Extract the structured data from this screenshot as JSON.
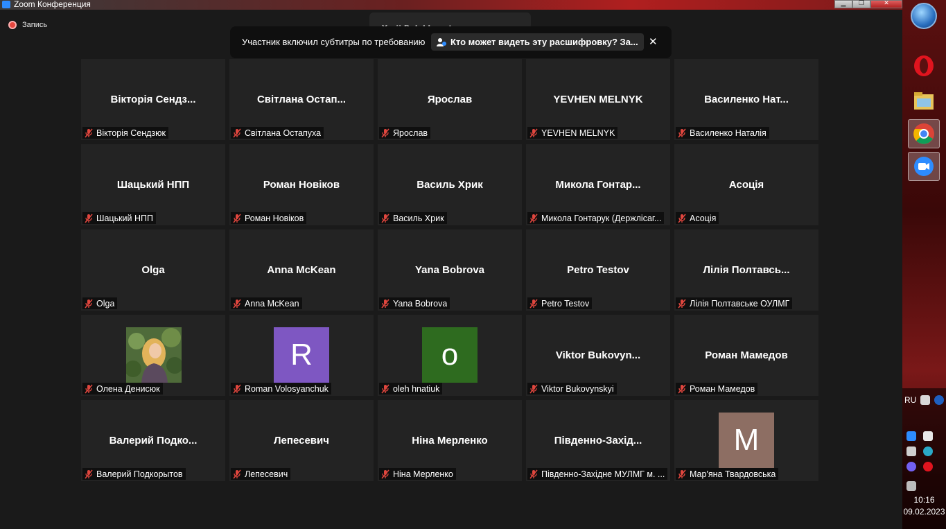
{
  "window": {
    "title": "Zoom Конференция",
    "minimize": "▁",
    "maximize": "❐",
    "close": "✕"
  },
  "recording": {
    "label": "Запись"
  },
  "speaker": {
    "text": "Yurii Bolokhovets разговаривает..."
  },
  "banner": {
    "message": "Участник включил субтитры по требованию",
    "who_can_see": "Кто может видеть эту расшифровку? За...",
    "close": "✕"
  },
  "tiles": [
    {
      "big": "Вікторія  Сендз...",
      "label": "Вікторія Сендзюк",
      "muted": true
    },
    {
      "big": "Світлана  Остап...",
      "label": "Світлана Остапуха",
      "muted": true
    },
    {
      "big": "Ярослав",
      "label": "Ярослав",
      "muted": true
    },
    {
      "big": "YEVHEN MELNYK",
      "label": "YEVHEN MELNYK",
      "muted": true
    },
    {
      "big": "Василенко  Нат...",
      "label": "Василенко Наталія",
      "muted": true
    },
    {
      "big": "Шацький НПП",
      "label": "Шацький НПП",
      "muted": true
    },
    {
      "big": "Роман Новіков",
      "label": "Роман Новіков",
      "muted": true
    },
    {
      "big": "Василь Хрик",
      "label": "Василь Хрик",
      "muted": true
    },
    {
      "big": "Микола  Гонтар...",
      "label": "Микола Гонтарук (Держлісаг...",
      "muted": true
    },
    {
      "big": "Асоція",
      "label": "Асоція",
      "muted": true
    },
    {
      "big": "Olga",
      "label": "Olga",
      "muted": true
    },
    {
      "big": "Anna McKean",
      "label": "Anna McKean",
      "muted": true
    },
    {
      "big": "Yana Bobrova",
      "label": "Yana Bobrova",
      "muted": true
    },
    {
      "big": "Petro Testov",
      "label": "Petro Testov",
      "muted": true
    },
    {
      "big": "Лілія  Полтавсь...",
      "label": "Лілія Полтавське ОУЛМГ",
      "muted": true
    },
    {
      "big": "",
      "label": "Олена Денисюк",
      "muted": true,
      "photo": true
    },
    {
      "big": "",
      "label": "Roman Volosyanchuk",
      "muted": true,
      "avatar_letter": "R",
      "avatar_color": "#7e57c2"
    },
    {
      "big": "",
      "label": "oleh hnatiuk",
      "muted": true,
      "avatar_letter": "o",
      "avatar_color": "#2e6b1f"
    },
    {
      "big": "Viktor  Bukovyn...",
      "label": "Viktor Bukovynskyi",
      "muted": true
    },
    {
      "big": "Роман Мамедов",
      "label": "Роман Мамедов",
      "muted": true
    },
    {
      "big": "Валерий  Подко...",
      "label": "Валерий Подкорытов",
      "muted": true
    },
    {
      "big": "Лепесевич",
      "label": "Лепесевич",
      "muted": true
    },
    {
      "big": "Ніна Мерленко",
      "label": "Ніна Мерленко",
      "muted": true
    },
    {
      "big": "Південно-Захід...",
      "label": "Південно-Західне МУЛМГ м. ...",
      "muted": true
    },
    {
      "big": "",
      "label": "Мар'яна Твардовська",
      "muted": true,
      "avatar_letter": "M",
      "avatar_color": "#8d6e63"
    }
  ],
  "taskbar": {
    "apps": [
      "opera-icon",
      "explorer-icon",
      "chrome-icon",
      "zoom-icon"
    ],
    "language": "RU",
    "time": "10:16",
    "date": "09.02.2023"
  }
}
